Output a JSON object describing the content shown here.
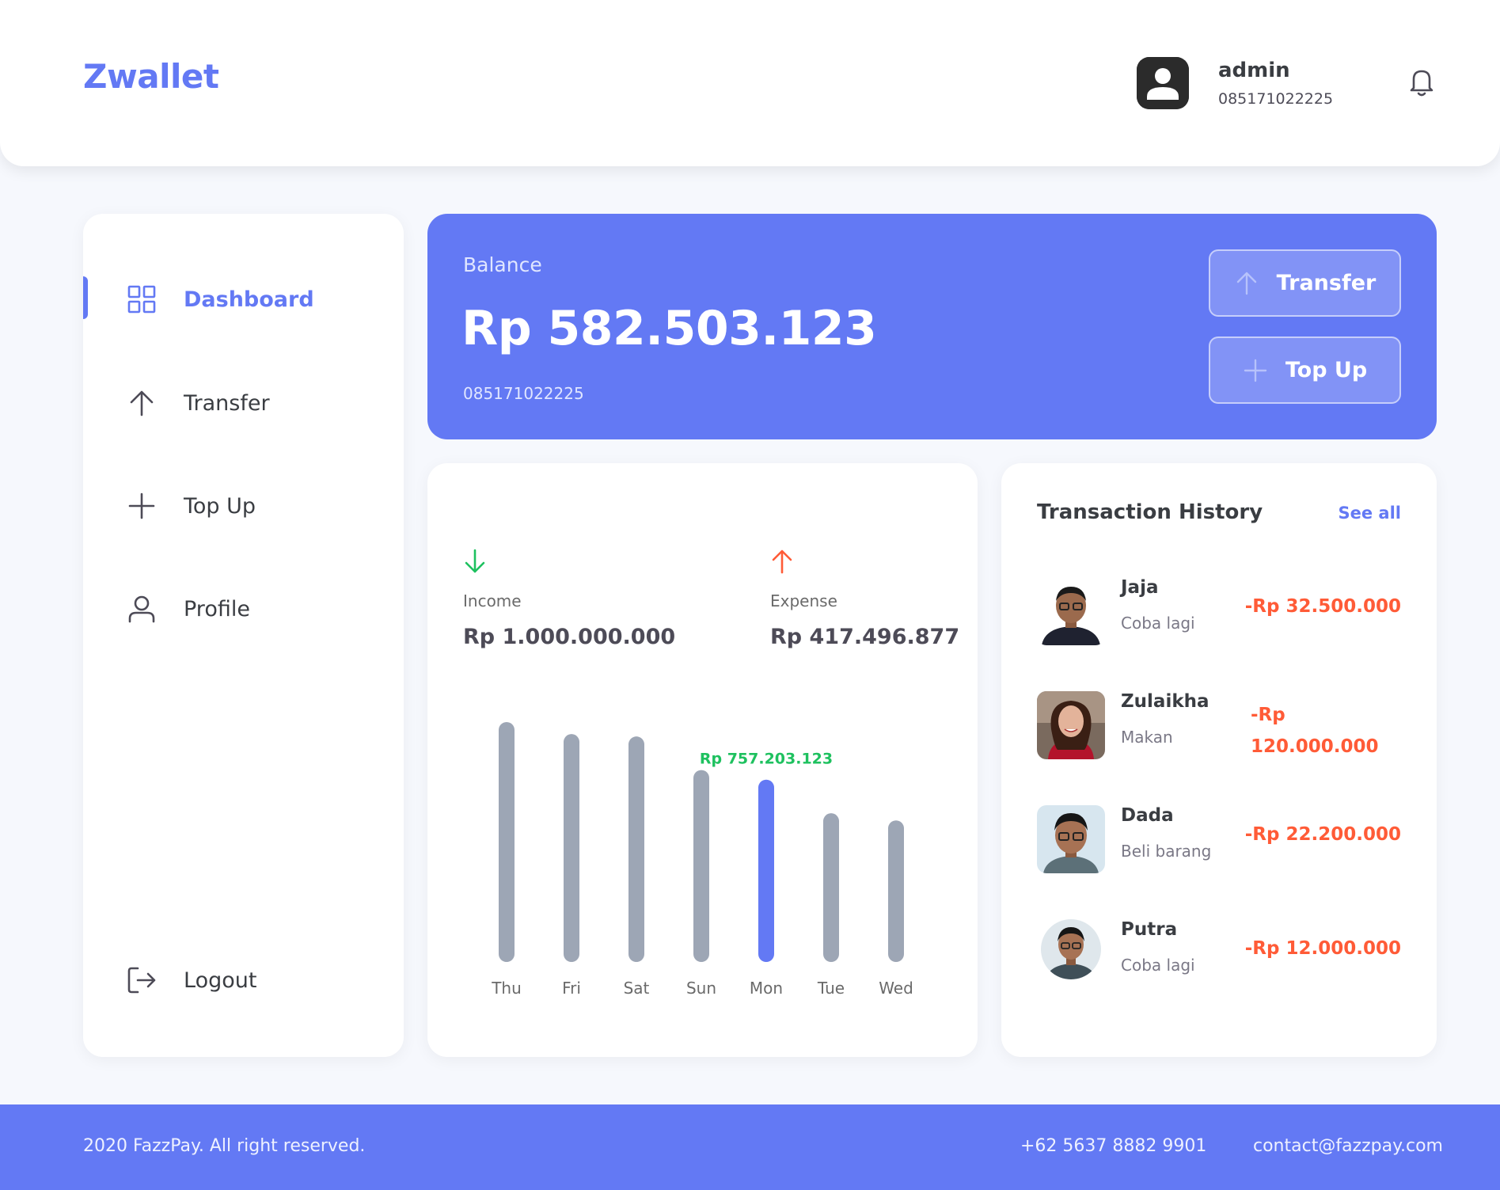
{
  "header": {
    "logo": "Zwallet",
    "user_name": "admin",
    "user_phone": "085171022225",
    "bell_icon": "bell-icon"
  },
  "sidebar": {
    "items": [
      {
        "label": "Dashboard",
        "icon": "grid-icon",
        "active": true
      },
      {
        "label": "Transfer",
        "icon": "arrow-up-icon",
        "active": false
      },
      {
        "label": "Top Up",
        "icon": "plus-icon",
        "active": false
      },
      {
        "label": "Profile",
        "icon": "user-icon",
        "active": false
      }
    ],
    "logout": {
      "label": "Logout",
      "icon": "logout-icon"
    }
  },
  "balance": {
    "label": "Balance",
    "amount": "Rp 582.503.123",
    "phone": "085171022225",
    "transfer_label": "Transfer",
    "topup_label": "Top Up"
  },
  "stats": {
    "income_label": "Income",
    "income_value": "Rp 1.000.000.000",
    "expense_label": "Expense",
    "expense_value": "Rp 417.496.877"
  },
  "chart_data": {
    "type": "bar",
    "categories": [
      "Thu",
      "Fri",
      "Sat",
      "Sun",
      "Mon",
      "Tue",
      "Wed"
    ],
    "values": [
      1.0,
      0.95,
      0.94,
      0.8,
      0.76,
      0.62,
      0.59
    ],
    "highlight_index": 4,
    "highlight_label": "Rp 757.203.123",
    "colors": {
      "bar": "#9da6b5",
      "highlight": "#6379f4",
      "label": "#1ec15f"
    }
  },
  "history": {
    "title": "Transaction History",
    "see_all": "See all",
    "items": [
      {
        "name": "Jaja",
        "note": "Coba lagi",
        "amount": "-Rp 32.500.000"
      },
      {
        "name": "Zulaikha",
        "note": "Makan",
        "amount": "-Rp 120.000.000"
      },
      {
        "name": "Dada",
        "note": "Beli barang",
        "amount": "-Rp 22.200.000"
      },
      {
        "name": "Putra",
        "note": "Coba lagi",
        "amount": "-Rp 12.000.000"
      }
    ]
  },
  "footer": {
    "copyright": "2020 FazzPay. All right reserved.",
    "phone": "+62 5637 8882 9901",
    "email": "contact@fazzpay.com"
  },
  "colors": {
    "primary": "#6379f4",
    "income": "#1ec15f",
    "expense": "#ff5b37"
  }
}
